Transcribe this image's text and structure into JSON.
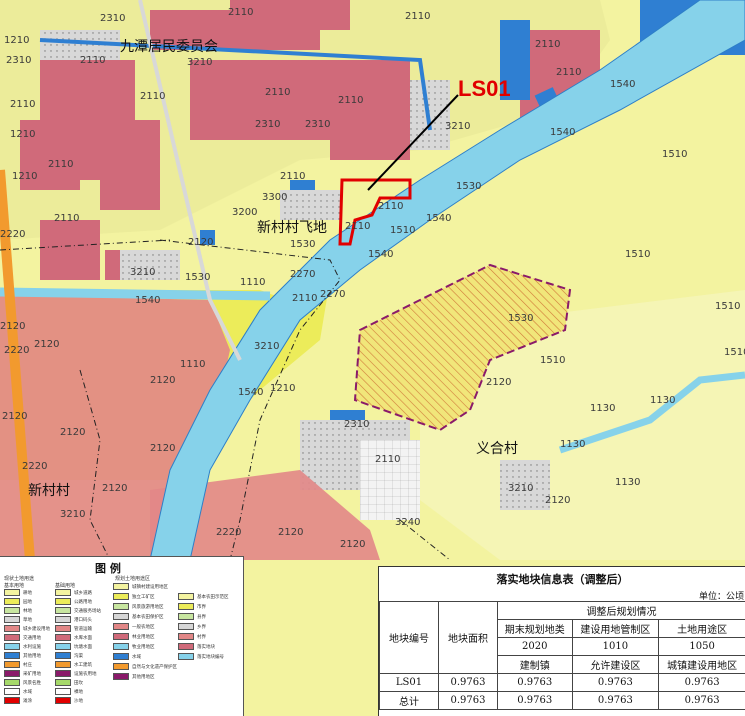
{
  "map": {
    "callout": "LS01",
    "places": {
      "committee": "九潭居民委员会",
      "xincun_fei": "新村村飞地",
      "yihe": "义合村",
      "xincun": "新村村"
    },
    "codes": {
      "c2110": "2110",
      "c2310": "2310",
      "c1210": "1210",
      "c1110": "1110",
      "c1130": "1130",
      "c1510": "1510",
      "c1530": "1530",
      "c1540": "1540",
      "c2120": "2120",
      "c2220": "2220",
      "c2270": "2270",
      "c3200": "3200",
      "c3210": "3210",
      "c3240": "3240",
      "c3300": "3300"
    },
    "colors": {
      "farmland": "#f3f3a0",
      "yellow_zone": "#ecec5a",
      "urban": "#d06a7a",
      "rural": "#e28787",
      "water": "#86d2ea",
      "blue_land": "#2f7fd2",
      "gray_land": "#d6d6d6",
      "boundary_red": "#e10000",
      "purple": "#8a1a6a"
    }
  },
  "legend": {
    "title": "图  例",
    "col1_head": "现状土地用途",
    "col1_sub": "基本用地",
    "col2_head": "基础用地",
    "col3_head": "规划土地用途区",
    "items_left": [
      "耕地",
      "园地",
      "林地",
      "草地",
      "城乡建设用地",
      "交通用地",
      "水利设施",
      "其他用地",
      "村庄",
      "采矿用地",
      "风景名胜",
      "水域",
      "滩涂"
    ],
    "items_mid": [
      "城乡道路",
      "公路用地",
      "交通服务场站",
      "港口码头",
      "管道运输",
      "水库水面",
      "坑塘水面",
      "沟渠",
      "水工建筑",
      "设施农用地",
      "田坎",
      "裸地",
      "沙地"
    ],
    "items_right": [
      "城镇村建设用地区",
      "独立工矿区",
      "风景旅游用地区",
      "基本农田保护区",
      "一般农地区",
      "林业用地区",
      "牧业用地区",
      "水域",
      "自然与文化遗产保护区",
      "其他用地区"
    ],
    "items_far": [
      "基本农田示范区",
      "市界",
      "县界",
      "乡界",
      "村界",
      "落实地块",
      "落实地块编号"
    ]
  },
  "info": {
    "title": "落实地块信息表（调整后）",
    "unit": "单位：公顷",
    "h_id": "地块编号",
    "h_area": "地块面积",
    "h_group": "调整后规划情况",
    "h_c1": "期末规划地类",
    "h_c2": "建设用地管制区",
    "h_c3": "土地用途区",
    "code1": "2020",
    "code2": "1010",
    "code3": "1050",
    "name1": "建制镇",
    "name2": "允许建设区",
    "name3": "城镇建设用地区",
    "row1": {
      "id": "LS01",
      "area": "0.9763",
      "v1": "0.9763",
      "v2": "0.9763",
      "v3": "0.9763"
    },
    "row2": {
      "id": "总计",
      "area": "0.9763",
      "v1": "0.9763",
      "v2": "0.9763",
      "v3": "0.9763"
    }
  }
}
